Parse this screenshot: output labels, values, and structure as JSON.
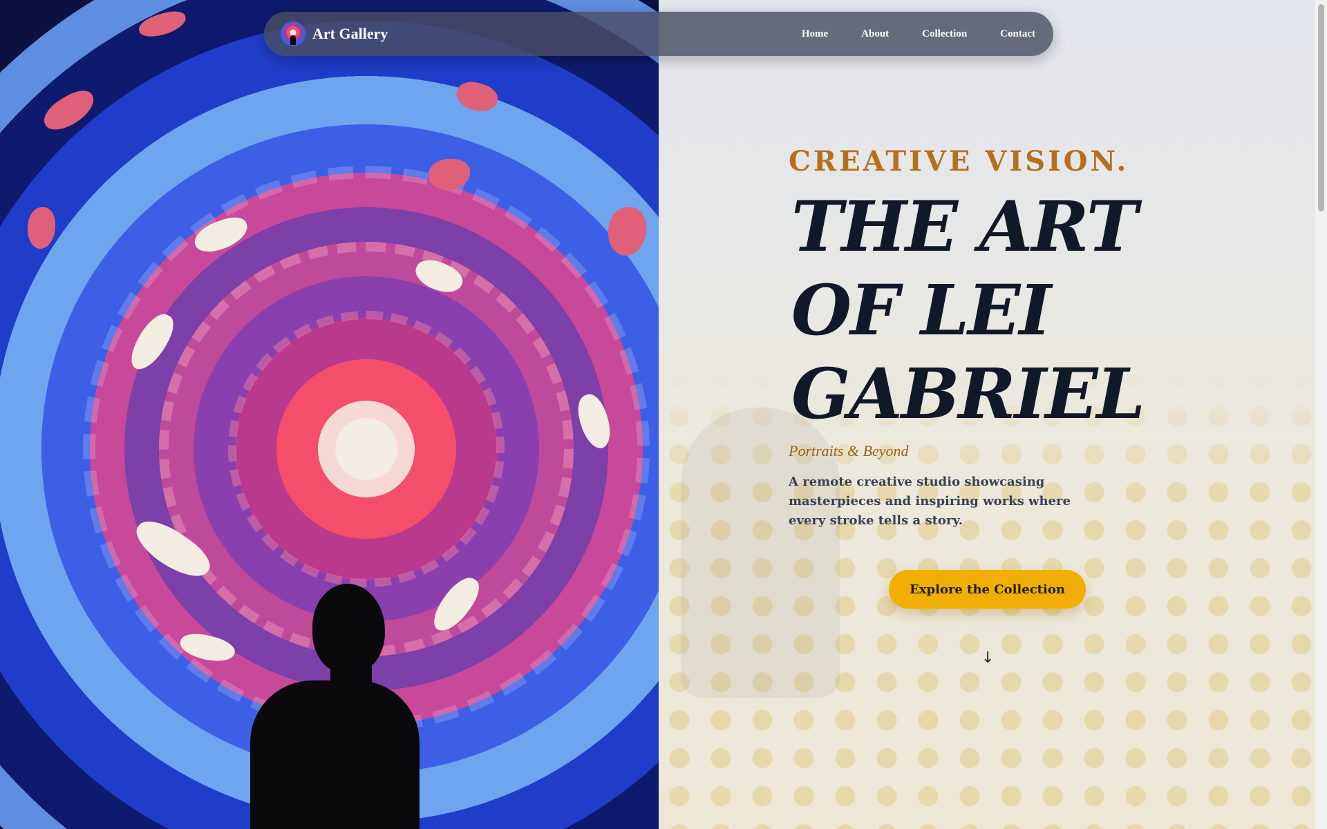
{
  "nav": {
    "brand": "Art Gallery",
    "links": [
      "Home",
      "About",
      "Collection",
      "Contact"
    ]
  },
  "hero": {
    "eyebrow": "CREATIVE VISION.",
    "headline_lines": [
      "THE ART",
      "OF LEI",
      "GABRIEL"
    ],
    "subtitle": "Portraits & Beyond",
    "description": "A remote creative studio showcasing masterpieces and inspiring works where every stroke tells a story.",
    "cta_label": "Explore the Collection",
    "scroll_arrow": "↓"
  },
  "colors": {
    "accent": "#f0ae06",
    "eyebrow": "#b5701c",
    "headline": "#111827",
    "nav_bg": "#4a4e64"
  },
  "icons": [
    "logo-icon",
    "down-arrow-icon"
  ]
}
